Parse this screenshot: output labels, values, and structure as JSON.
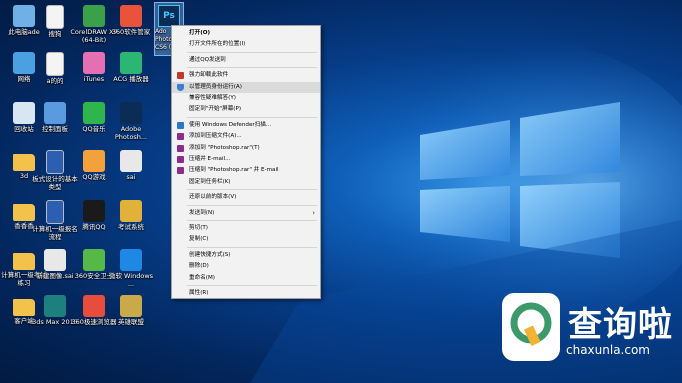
{
  "desktop": {
    "icons_col1": [
      {
        "label": "此电脑ade",
        "icon": "computer-icon",
        "color": "#6fb1e6"
      },
      {
        "label": "网络",
        "icon": "network-icon",
        "color": "#4aa0e0"
      },
      {
        "label": "回收站",
        "icon": "recycle-bin-icon",
        "color": "#d8e6f2"
      },
      {
        "label": "3d",
        "icon": "folder-icon",
        "color": "#f3c24a"
      },
      {
        "label": "香香香",
        "icon": "folder-icon",
        "color": "#f3c24a"
      },
      {
        "label": "计算机一级考试练习",
        "icon": "folder-icon",
        "color": "#f3c24a"
      },
      {
        "label": "客户端",
        "icon": "folder-icon",
        "color": "#f3c24a"
      }
    ],
    "icons_col2": [
      {
        "label": "搜狗",
        "icon": "document-icon",
        "color": "#f4f4f4"
      },
      {
        "label": "a的的",
        "icon": "document-icon",
        "color": "#f4f4f4"
      },
      {
        "label": "控制面板",
        "icon": "control-panel-icon",
        "color": "#5a9be0"
      },
      {
        "label": "板式设计的基本类型",
        "icon": "word-doc-icon",
        "color": "#2b5fb4"
      },
      {
        "label": "计算机一级报名流程",
        "icon": "word-doc-icon",
        "color": "#2b5fb4"
      },
      {
        "label": "新建图像.sai",
        "icon": "sai-file-icon",
        "color": "#e8e8e8"
      },
      {
        "label": "3ds Max 2015",
        "icon": "3dsmax-icon",
        "color": "#1e7f7f"
      }
    ],
    "icons_col3": [
      {
        "label": "CorelDRAW X7 (64-Bit)",
        "icon": "coreldraw-icon",
        "color": "#3aa14a"
      },
      {
        "label": "iTunes",
        "icon": "itunes-icon",
        "color": "#e46fb2"
      },
      {
        "label": "QQ音乐",
        "icon": "qq-music-icon",
        "color": "#2fb54d"
      },
      {
        "label": "QQ游戏",
        "icon": "qq-game-icon",
        "color": "#f2a13b"
      },
      {
        "label": "腾讯QQ",
        "icon": "qq-icon",
        "color": "#1a1a1a"
      },
      {
        "label": "360安全卫士",
        "icon": "360-safe-icon",
        "color": "#56b947"
      },
      {
        "label": "360极速浏览器",
        "icon": "360-browser-icon",
        "color": "#e74c3c"
      }
    ],
    "icons_col4": [
      {
        "label": "360软件管家",
        "icon": "360-manager-icon",
        "color": "#e8533a"
      },
      {
        "label": "ACG 播放器",
        "icon": "acg-player-icon",
        "color": "#2bb673"
      },
      {
        "label": "Adobe Photosh...",
        "icon": "photoshop-icon",
        "color": "#0b2d55"
      },
      {
        "label": "sai",
        "icon": "sai-app-icon",
        "color": "#e8e8e8"
      },
      {
        "label": "考试系统",
        "icon": "exam-system-icon",
        "color": "#e0b23a"
      },
      {
        "label": "微软 Windows ...",
        "icon": "windows-icon",
        "color": "#1e88e5"
      },
      {
        "label": "英雄联盟",
        "icon": "lol-icon",
        "color": "#c9a949"
      }
    ],
    "selected_icon": {
      "label": "Adobe Photoshop CS6",
      "label_visible": "Ado Photo CS6 (6",
      "icon": "photoshop-icon",
      "color": "#0b2d55"
    }
  },
  "context_menu": {
    "items": [
      {
        "label": "打开(O)",
        "bold": true,
        "icon": ""
      },
      {
        "label": "打开文件所在的位置(I)",
        "icon": ""
      },
      {
        "sep": true
      },
      {
        "label": "通过QQ发送到",
        "icon": ""
      },
      {
        "sep": true
      },
      {
        "label": "强力卸载此软件",
        "icon": "uninstall-icon"
      },
      {
        "label": "以管理员身份运行(A)",
        "icon": "shield-icon",
        "highlight": true
      },
      {
        "label": "兼容性疑难解答(Y)",
        "icon": ""
      },
      {
        "label": "固定到\"开始\"屏幕(P)",
        "icon": ""
      },
      {
        "sep": true
      },
      {
        "label": "使用 Windows Defender扫描...",
        "icon": "defender-icon"
      },
      {
        "label": "添加到压缩文件(A)...",
        "icon": "winrar-icon"
      },
      {
        "label": "添加到 \"Photoshop.rar\"(T)",
        "icon": "winrar-icon"
      },
      {
        "label": "压缩并 E-mail...",
        "icon": "winrar-icon"
      },
      {
        "label": "压缩到 \"Photoshop.rar\" 并 E-mail",
        "icon": "winrar-icon"
      },
      {
        "label": "固定到任务栏(K)",
        "icon": ""
      },
      {
        "sep": true
      },
      {
        "label": "还原以前的版本(V)",
        "icon": ""
      },
      {
        "sep": true
      },
      {
        "label": "发送到(N)",
        "icon": "",
        "submenu": true
      },
      {
        "sep": true
      },
      {
        "label": "剪切(T)",
        "icon": ""
      },
      {
        "label": "复制(C)",
        "icon": ""
      },
      {
        "sep": true
      },
      {
        "label": "创建快捷方式(S)",
        "icon": ""
      },
      {
        "label": "删除(D)",
        "icon": ""
      },
      {
        "label": "重命名(M)",
        "icon": ""
      },
      {
        "sep": true
      },
      {
        "label": "属性(R)",
        "icon": ""
      }
    ],
    "colors": {
      "background": "#f2f2f2",
      "highlight": "#dadada"
    }
  },
  "watermark": {
    "text": "查询啦",
    "url": "chaxunla.com",
    "brand_color": "#3c9a6a"
  }
}
